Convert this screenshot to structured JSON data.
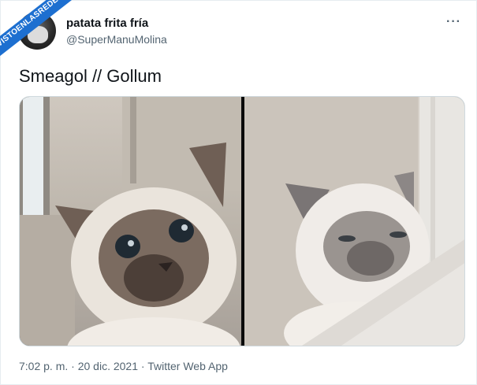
{
  "watermark": {
    "text": "VISTOENLASREDES.com"
  },
  "author": {
    "name": "patata frita fría",
    "handle": "@SuperManuMolina",
    "avatar_icon": "avatar-person-icon"
  },
  "more_menu": {
    "label": "···",
    "icon": "more-options-icon"
  },
  "tweet": {
    "text": "Smeagol // Gollum"
  },
  "media": {
    "left_image": {
      "description_icon": "cat-photo"
    },
    "right_image": {
      "description_icon": "cat-photo"
    }
  },
  "footer": {
    "time": "7:02 p. m.",
    "sep1": " · ",
    "date": "20 dic. 2021",
    "sep2": " · ",
    "source": "Twitter Web App"
  },
  "colors": {
    "text_primary": "#0f1419",
    "text_secondary": "#536471",
    "watermark_blue": "#1d6fd0"
  }
}
